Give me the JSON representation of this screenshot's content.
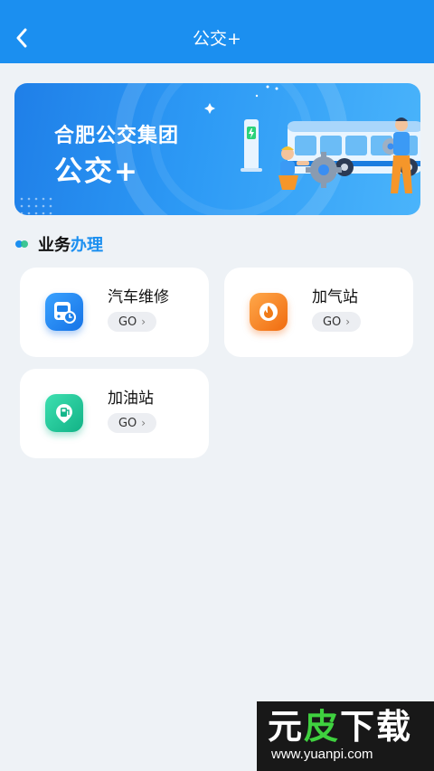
{
  "header": {
    "title": "公交+",
    "back_icon": "chevron-left-icon"
  },
  "banner": {
    "line1": "合肥公交集团",
    "line2": "公交+"
  },
  "section": {
    "title_a": "业务",
    "title_b": "办理"
  },
  "cards": [
    {
      "label": "汽车维修",
      "go": "GO",
      "icon": "bus-repair-icon",
      "color": "#1f86ef"
    },
    {
      "label": "加气站",
      "go": "GO",
      "icon": "flame-icon",
      "color": "#f57a17"
    },
    {
      "label": "加油站",
      "go": "GO",
      "icon": "fuel-pump-icon",
      "color": "#1ec79a"
    }
  ],
  "watermark": {
    "big_a": "元",
    "big_b": "皮",
    "big_c": "下载",
    "url": "www.yuanpi.com"
  },
  "colors": {
    "primary": "#1b8ff0",
    "background": "#eef2f6"
  }
}
